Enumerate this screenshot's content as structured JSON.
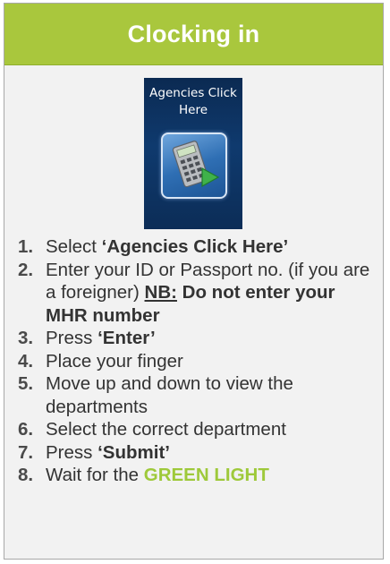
{
  "header": {
    "title": "Clocking in"
  },
  "icon": {
    "label_line1": "Agencies Click",
    "label_line2": "Here",
    "name": "calculator-arrow-icon"
  },
  "colors": {
    "header_bg": "#a9c73d",
    "highlight_green": "#9ec93a"
  },
  "steps": [
    {
      "num": "1.",
      "pre": "Select ",
      "bold": "‘Agencies Click Here’"
    },
    {
      "num": "2.",
      "text": "Enter your ID or Passport no. (if you are a foreigner) ",
      "nb": "NB:",
      "warning": " Do not enter your MHR number"
    },
    {
      "num": "3.",
      "pre": "Press ",
      "bold": "‘Enter’"
    },
    {
      "num": "4.",
      "text": "Place your finger"
    },
    {
      "num": "5.",
      "text": "Move up and down to view the departments"
    },
    {
      "num": "6.",
      "text": "Select the correct department"
    },
    {
      "num": "7.",
      "pre": "Press ",
      "bold": "‘Submit’"
    },
    {
      "num": "8.",
      "pre": "Wait for the ",
      "green": "GREEN LIGHT"
    }
  ]
}
